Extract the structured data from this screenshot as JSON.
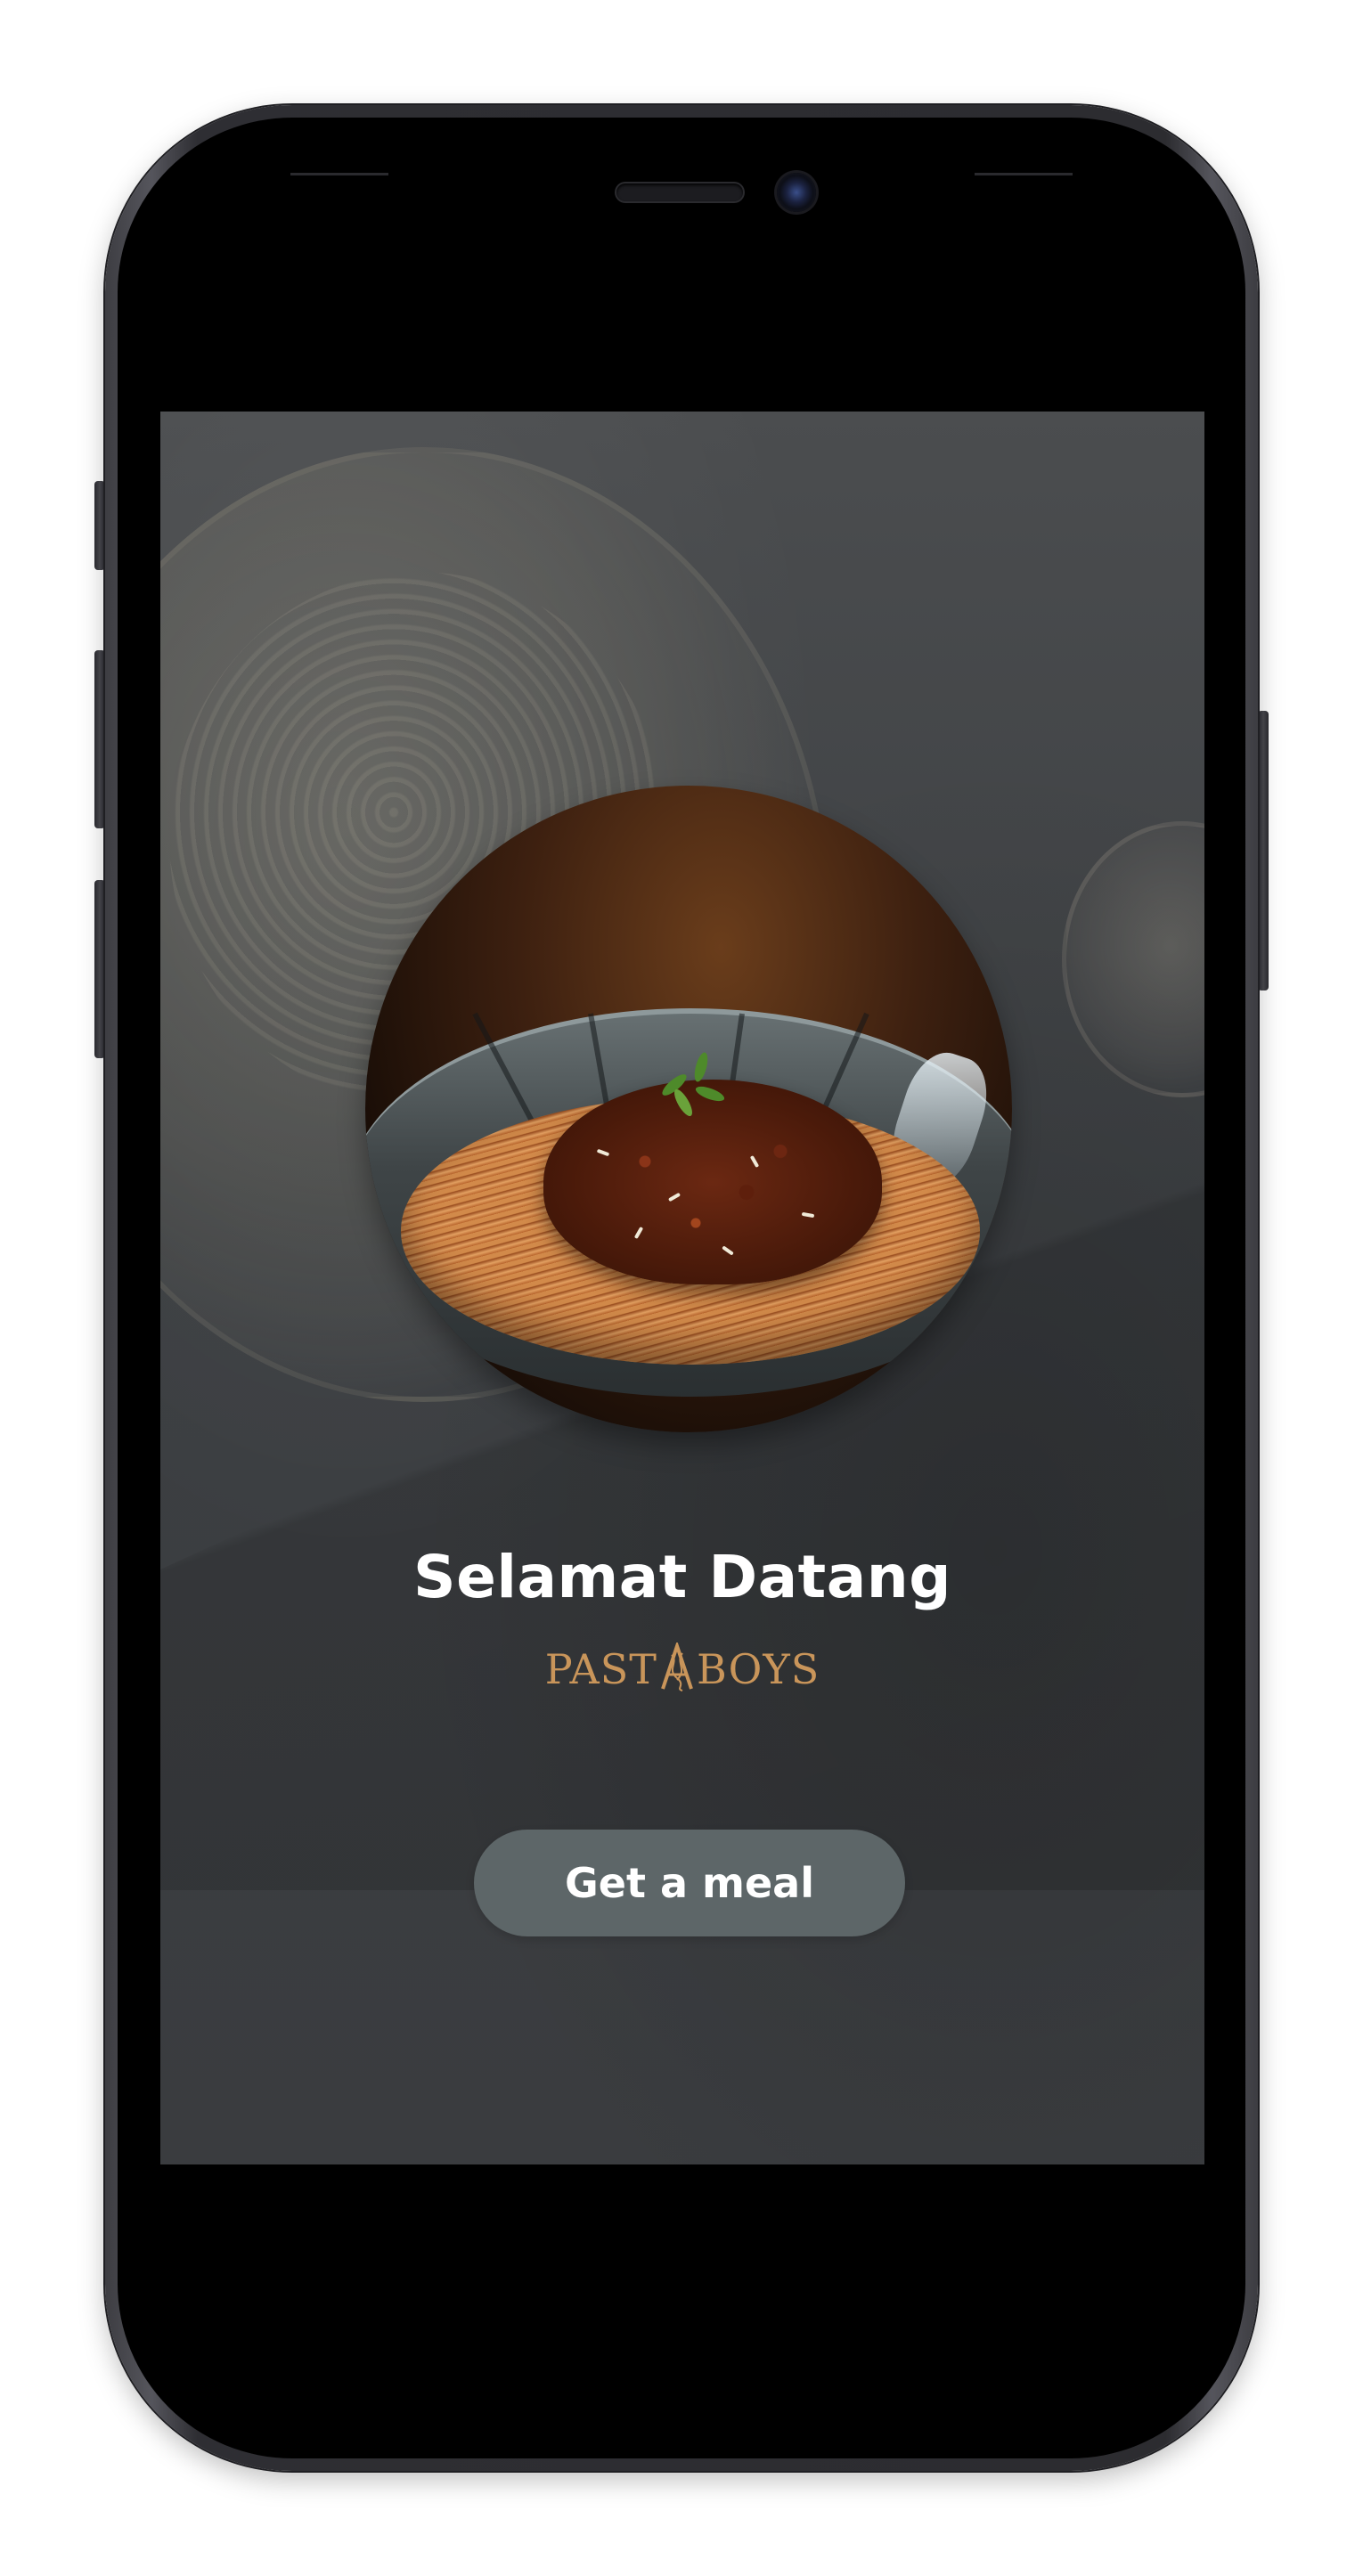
{
  "app": {
    "welcome_title": "Selamat Datang",
    "brand_logo_text": "PASTABOYS",
    "brand_color": "#c9955a"
  },
  "actions": {
    "cta_label": "Get a meal"
  },
  "hero": {
    "image_icon": "pasta-bowl-photo"
  }
}
